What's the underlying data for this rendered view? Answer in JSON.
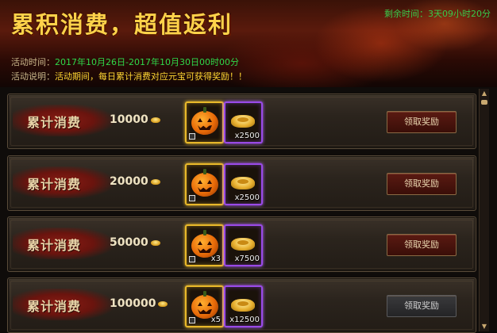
{
  "header": {
    "title": "累积消费，超值返利",
    "timer_label": "剩余时间：",
    "timer_value": "3天09小时20分",
    "period_label": "活动时间：",
    "period_value": "2017年10月26日-2017年10月30日00时00分",
    "desc_label": "活动说明：",
    "desc_value": "活动期间，每日累计消费对应元宝可获得奖励！！"
  },
  "rows": [
    {
      "tag": "累计消费",
      "amount": "10000",
      "item1_qty": "",
      "item2_qty": "x2500",
      "button": "领取奖励",
      "button_state": "active"
    },
    {
      "tag": "累计消费",
      "amount": "20000",
      "item1_qty": "",
      "item2_qty": "x2500",
      "button": "领取奖励",
      "button_state": "active"
    },
    {
      "tag": "累计消费",
      "amount": "50000",
      "item1_qty": "x3",
      "item2_qty": "x7500",
      "button": "领取奖励",
      "button_state": "active"
    },
    {
      "tag": "累计消费",
      "amount": "100000",
      "item1_qty": "x5",
      "item2_qty": "x12500",
      "button": "领取奖励",
      "button_state": "disabled"
    }
  ],
  "icons": {
    "currency": "gold-ingot-icon",
    "item1": "pumpkin-lantern-icon",
    "item2": "gold-ingot-icon",
    "scroll_up": "arrow-up-icon",
    "scroll_down": "arrow-down-icon"
  },
  "colors": {
    "title": "#ffd24a",
    "timer": "#39c84a",
    "period": "#2fd84a",
    "desc": "#ffd633",
    "item1_border": "#e8b82a",
    "item2_border": "#9a4ae8"
  }
}
